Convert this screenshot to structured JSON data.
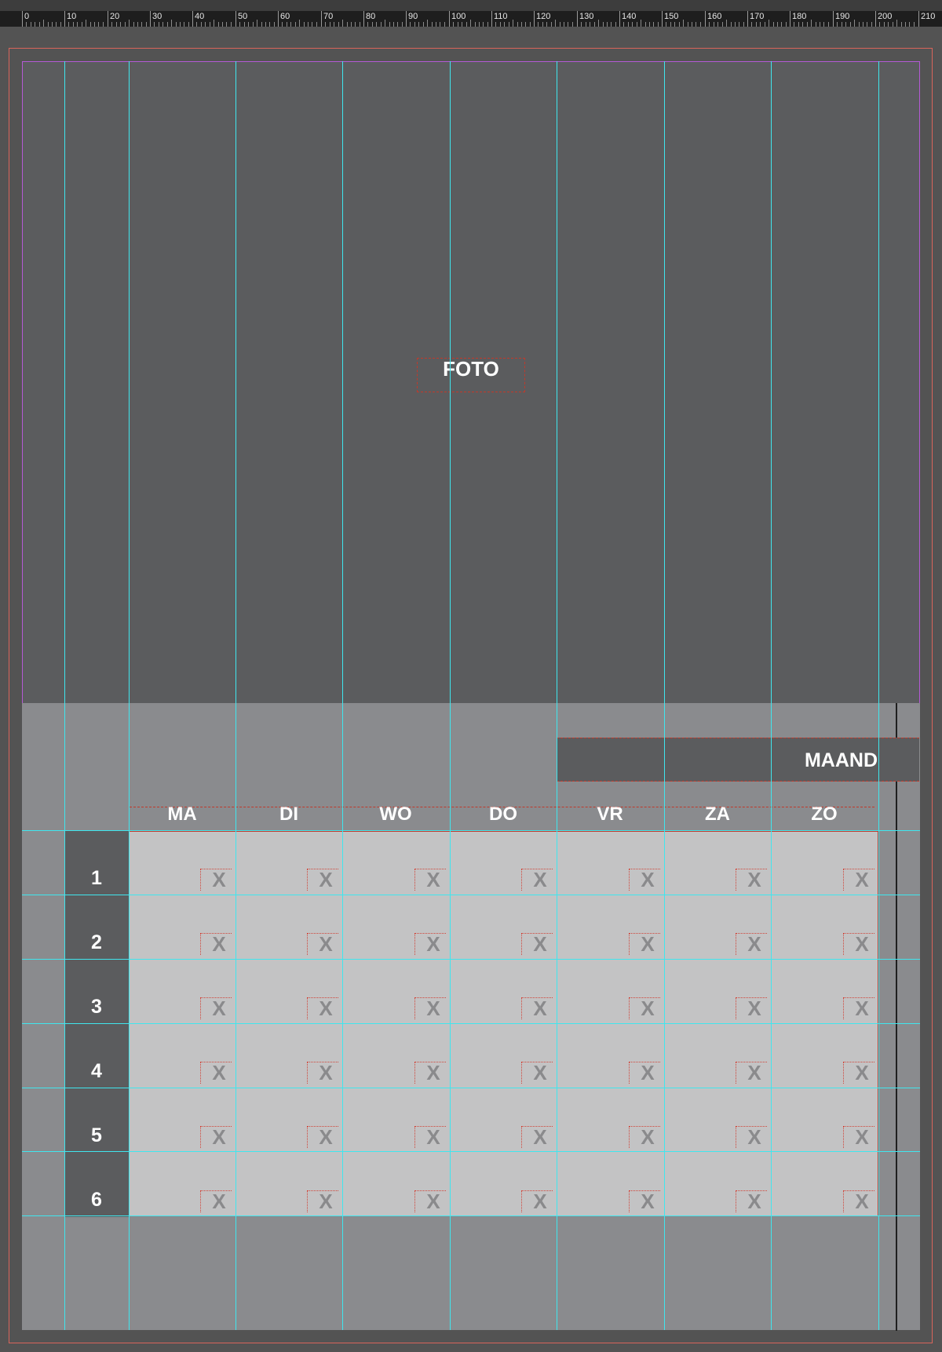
{
  "ruler": {
    "labels": [
      "0",
      "10",
      "20",
      "30",
      "40",
      "50",
      "60",
      "70",
      "80",
      "90",
      "100",
      "110",
      "120",
      "130",
      "140",
      "150",
      "160",
      "170",
      "180",
      "190",
      "200",
      "210"
    ]
  },
  "photo": {
    "label": "FOTO"
  },
  "calendar": {
    "month_label": "MAAND",
    "day_headers": [
      "MA",
      "DI",
      "WO",
      "DO",
      "VR",
      "ZA",
      "ZO"
    ],
    "week_numbers": [
      "1",
      "2",
      "3",
      "4",
      "5",
      "6"
    ],
    "date_placeholder": "X"
  },
  "colors": {
    "guide": "#3fe6ee",
    "margin": "#b45ad6",
    "bleed": "#d9655b",
    "frame": "#c0392b"
  }
}
